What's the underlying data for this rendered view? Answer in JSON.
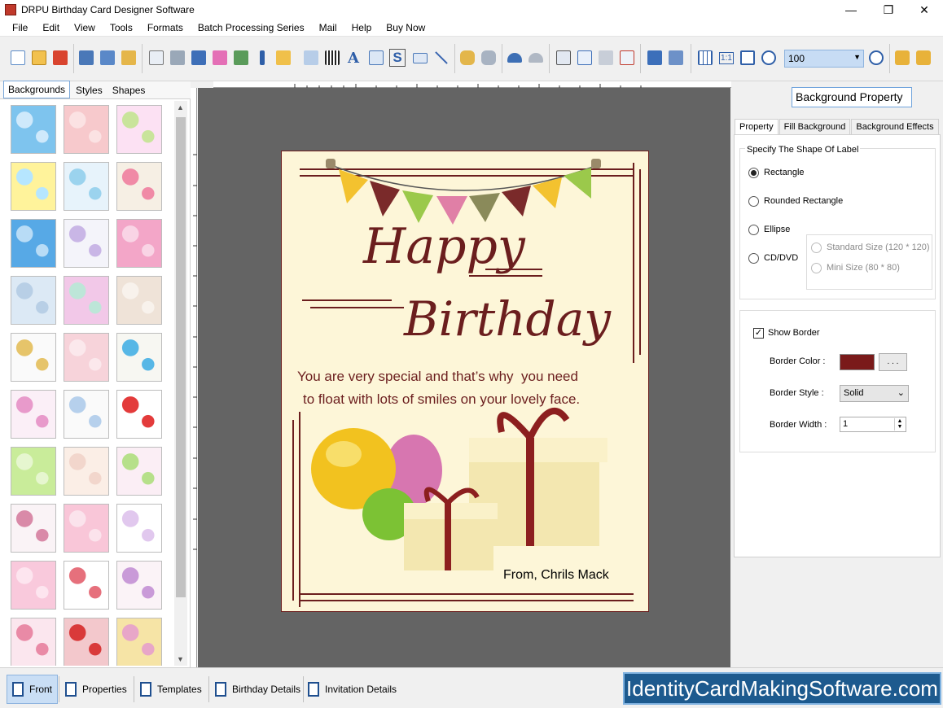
{
  "window": {
    "title": "DRPU Birthday Card Designer Software",
    "controls": [
      "—",
      "❐",
      "✕"
    ]
  },
  "menu": [
    "File",
    "Edit",
    "View",
    "Tools",
    "Formats",
    "Batch Processing Series",
    "Mail",
    "Help",
    "Buy Now"
  ],
  "toolbar": {
    "zoom_value": "100"
  },
  "left_panel": {
    "tabs": [
      "Backgrounds",
      "Styles",
      "Shapes"
    ],
    "active_tab": "Backgrounds"
  },
  "card": {
    "line1": "Happy",
    "line2": "Birthday",
    "message1": "You are very special and that’s why  you need",
    "message2": "to float with lots of smiles on your lovely face.",
    "from": "From, Chrils Mack",
    "colors": {
      "background": "#fdf6d8",
      "text": "#6b1e1e"
    }
  },
  "right_panel": {
    "header": "Background Property",
    "tabs": [
      "Property",
      "Fill Background",
      "Background Effects"
    ],
    "shape_group_label": "Specify The Shape Of Label",
    "shapes": [
      {
        "label": "Rectangle",
        "selected": true
      },
      {
        "label": "Rounded Rectangle",
        "selected": false
      },
      {
        "label": "Ellipse",
        "selected": false
      },
      {
        "label": "CD/DVD",
        "selected": false
      }
    ],
    "cd_sizes": [
      "Standard Size (120 * 120)",
      "Mini Size (80 * 80)"
    ],
    "show_border_label": "Show Border",
    "show_border_checked": true,
    "border_color_label": "Border Color :",
    "border_color": "#7a1a1a",
    "border_color_button": ". . .",
    "border_style_label": "Border Style :",
    "border_style_value": "Solid",
    "border_width_label": "Border Width :",
    "border_width_value": "1"
  },
  "bottom_tabs": [
    "Front",
    "Properties",
    "Templates",
    "Birthday Details",
    "Invitation Details"
  ],
  "brand": "IdentityCardMakingSoftware.com"
}
